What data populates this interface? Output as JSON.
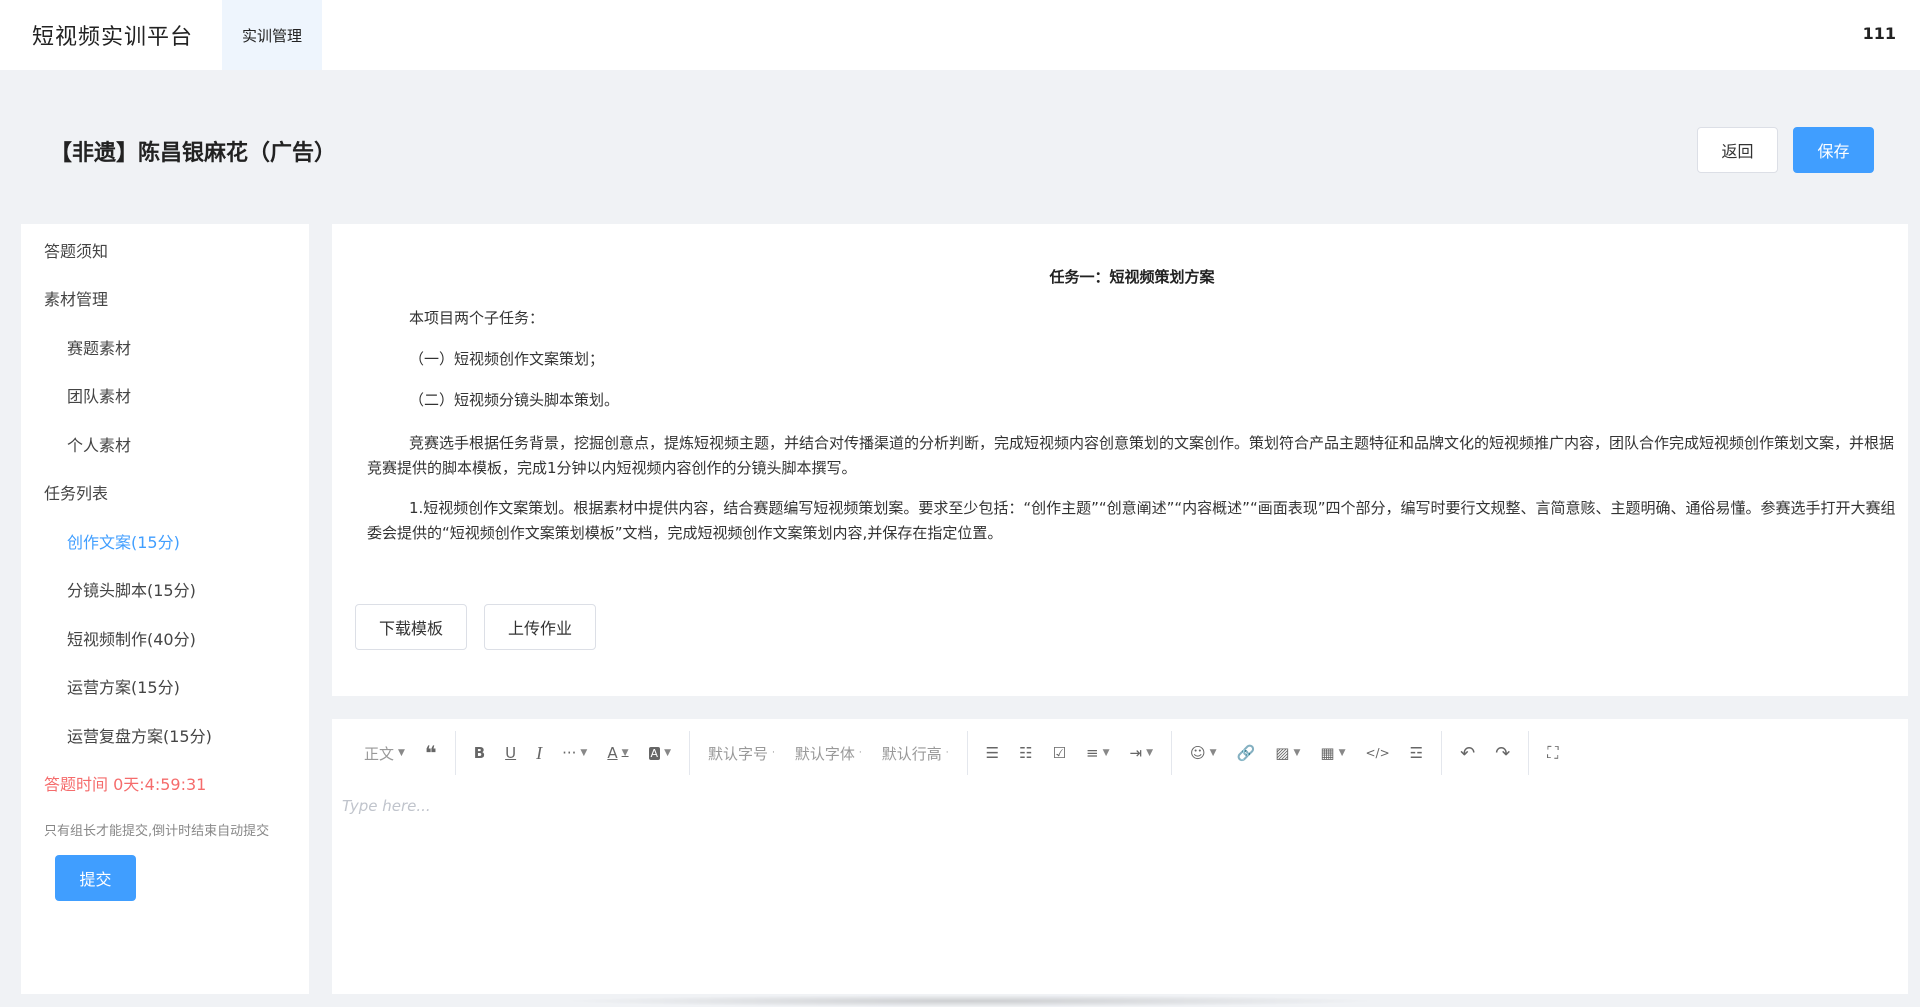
{
  "header": {
    "brand": "短视频实训平台",
    "nav_tab": "实训管理",
    "user_id": "111"
  },
  "page": {
    "title": "【非遗】陈昌银麻花（广告）",
    "back_label": "返回",
    "save_label": "保存"
  },
  "sidebar": {
    "items": [
      {
        "label": "答题须知"
      },
      {
        "label": "素材管理"
      },
      {
        "label": "赛题素材"
      },
      {
        "label": "团队素材"
      },
      {
        "label": "个人素材"
      },
      {
        "label": "任务列表"
      },
      {
        "label": "创作文案(15分)"
      },
      {
        "label": "分镜头脚本(15分)"
      },
      {
        "label": "短视频制作(40分)"
      },
      {
        "label": "运营方案(15分)"
      },
      {
        "label": "运营复盘方案(15分)"
      }
    ],
    "timer": "答题时间 0天:4:59:31",
    "note": "只有组长才能提交,倒计时结束自动提交",
    "submit_label": "提交"
  },
  "task": {
    "heading": "任务一：短视频策划方案",
    "p1": "本项目两个子任务：",
    "p2": "（一）短视频创作文案策划；",
    "p3": "（二）短视频分镜头脚本策划。",
    "p4": "竞赛选手根据任务背景，挖掘创意点，提炼短视频主题，并结合对传播渠道的分析判断，完成短视频内容创意策划的文案创作。策划符合产品主题特征和品牌文化的短视频推广内容，团队合作完成短视频创作策划文案，并根据竞赛提供的脚本模板，完成1分钟以内短视频内容创作的分镜头脚本撰写。",
    "p5": "1.短视频创作文案策划。根据素材中提供内容，结合赛题编写短视频策划案。要求至少包括：“创作主题”“创意阐述”“内容概述”“画面表现”四个部分，编写时要行文规整、言简意赅、主题明确、通俗易懂。参赛选手打开大赛组委会提供的“短视频创作文案策划模板”文档，完成短视频创作文案策划内容,并保存在指定位置。",
    "download_label": "下载模板",
    "upload_label": "上传作业"
  },
  "editor": {
    "paragraph_style": "正文",
    "font_size": "默认字号",
    "font_family": "默认字体",
    "line_height": "默认行高",
    "placeholder": "Type here..."
  },
  "colors": {
    "primary": "#409eff",
    "danger": "#f56c6c",
    "background": "#f0f2f5"
  }
}
